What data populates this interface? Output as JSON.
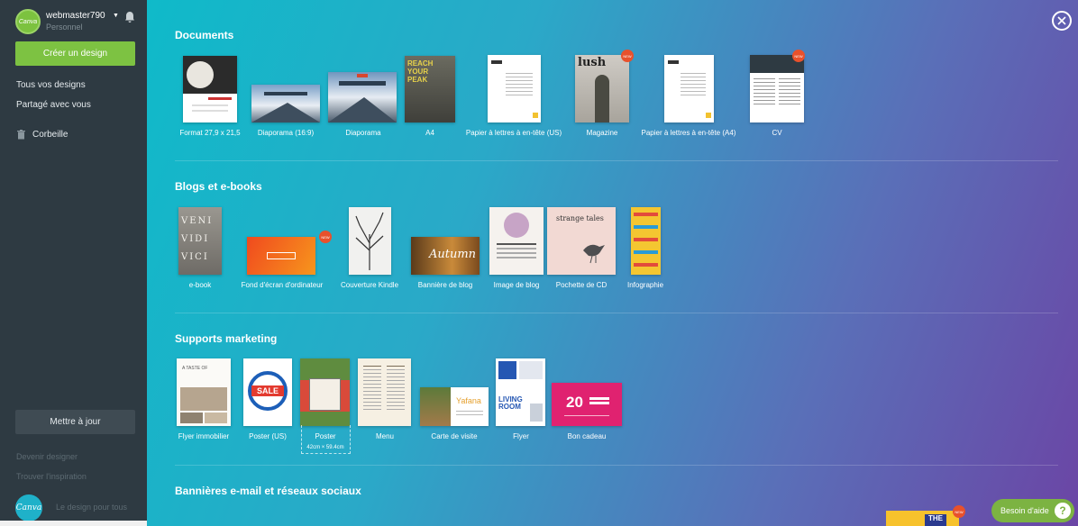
{
  "sidebar": {
    "username": "webmaster790",
    "plan": "Personnel",
    "create_button": "Créer un design",
    "nav": [
      "Tous vos designs",
      "Partagé avec vous",
      "Corbeille"
    ],
    "update_button": "Mettre à jour",
    "links": [
      "Devenir designer",
      "Trouver l'inspiration"
    ],
    "logo_text": "Canva",
    "tagline": "Le design pour tous"
  },
  "sections": [
    {
      "title": "Documents",
      "items": [
        {
          "label": "Format 27,9 x 21,5",
          "new": false
        },
        {
          "label": "Diaporama (16:9)",
          "new": false
        },
        {
          "label": "Diaporama",
          "new": false
        },
        {
          "label": "A4",
          "new": false,
          "thumb_text": "REACH YOUR PEAK"
        },
        {
          "label": "Papier à lettres à en-tête (US)",
          "new": false
        },
        {
          "label": "Magazine",
          "new": true,
          "thumb_text": "lush"
        },
        {
          "label": "Papier à lettres à en-tête (A4)",
          "new": false
        },
        {
          "label": "CV",
          "new": true
        }
      ]
    },
    {
      "title": "Blogs et e-books",
      "items": [
        {
          "label": "e-book",
          "new": false,
          "thumb_text": "VENI VIDI VICI"
        },
        {
          "label": "Fond d'écran d'ordinateur",
          "new": true
        },
        {
          "label": "Couverture Kindle",
          "new": false
        },
        {
          "label": "Bannière de blog",
          "new": false,
          "thumb_text": "Autumn"
        },
        {
          "label": "Image de blog",
          "new": false
        },
        {
          "label": "Pochette de CD",
          "new": false,
          "thumb_text": "strange tales"
        },
        {
          "label": "Infographie",
          "new": false
        }
      ]
    },
    {
      "title": "Supports marketing",
      "items": [
        {
          "label": "Flyer immobilier",
          "new": false,
          "thumb_text": "A TASTE OF"
        },
        {
          "label": "Poster (US)",
          "new": false,
          "thumb_text": "SALE"
        },
        {
          "label": "Poster",
          "new": false,
          "sub": "42cm × 59.4cm"
        },
        {
          "label": "Menu",
          "new": false
        },
        {
          "label": "Carte de visite",
          "new": false,
          "thumb_text": "Yafana"
        },
        {
          "label": "Flyer",
          "new": false,
          "thumb_text": "LIVING ROOM"
        },
        {
          "label": "Bon cadeau",
          "new": false,
          "thumb_text": "20"
        }
      ]
    },
    {
      "title": "Bannières e-mail et réseaux sociaux",
      "items": []
    }
  ],
  "new_badge": "NEW",
  "peek_text": "THE",
  "help_button": "Besoin d'aide",
  "help_icon": "?",
  "colors": {
    "sidebar": "#2e3a42",
    "accent": "#7dc242",
    "badge": "#e8512c"
  }
}
